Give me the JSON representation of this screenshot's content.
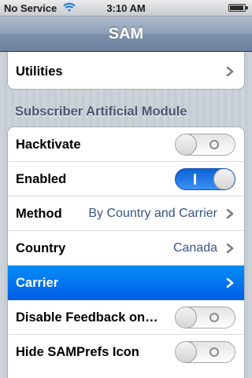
{
  "status_bar": {
    "carrier": "No Service",
    "time": "3:10 AM",
    "wifi_icon": "wifi-icon",
    "battery_icon": "battery-icon"
  },
  "navbar": {
    "title": "SAM"
  },
  "top_group": {
    "items": [
      {
        "label": "Utilities",
        "icon": "chevron-right-icon"
      }
    ]
  },
  "section": {
    "header": "Subscriber Artificial Module",
    "rows": [
      {
        "label": "Hacktivate",
        "type": "switch",
        "on": false
      },
      {
        "label": "Enabled",
        "type": "switch",
        "on": true
      },
      {
        "label": "Method",
        "type": "disclosure",
        "value": "By Country and Carrier"
      },
      {
        "label": "Country",
        "type": "disclosure",
        "value": "Canada"
      },
      {
        "label": "Carrier",
        "type": "disclosure",
        "value": "",
        "selected": true
      },
      {
        "label": "Disable Feedback on…",
        "type": "switch",
        "on": false
      },
      {
        "label": "Hide SAMPrefs Icon",
        "type": "switch",
        "on": false
      }
    ]
  },
  "colors": {
    "accent": "#2577e3",
    "selected_row": "#035fe6",
    "value_text": "#385487",
    "background": "#c5ccd4",
    "navbar": "#6d82a0"
  }
}
